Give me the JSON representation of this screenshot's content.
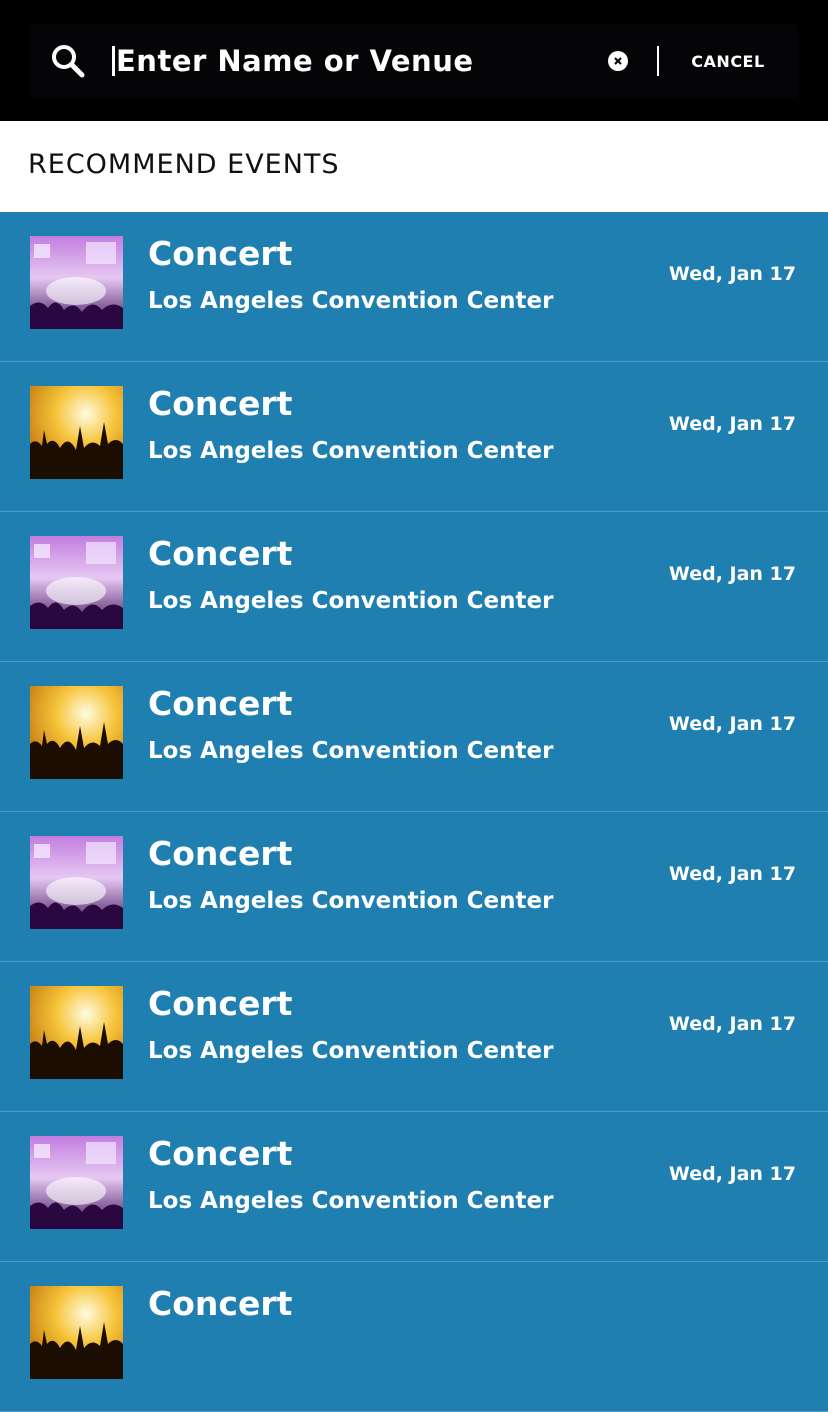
{
  "search": {
    "placeholder": "Enter Name or Venue",
    "value": "",
    "cancel_label": "CANCEL"
  },
  "section": {
    "title": "RECOMMEND EVENTS"
  },
  "events": [
    {
      "title": "Concert",
      "venue": "Los Angeles Convention Center",
      "date": "Wed, Jan 17",
      "thumb": "purple-concert-image"
    },
    {
      "title": "Concert",
      "venue": "Los Angeles Convention Center",
      "date": "Wed, Jan 17",
      "thumb": "golden-crowd-image"
    },
    {
      "title": "Concert",
      "venue": "Los Angeles Convention Center",
      "date": "Wed, Jan 17",
      "thumb": "purple-concert-image"
    },
    {
      "title": "Concert",
      "venue": "Los Angeles Convention Center",
      "date": "Wed, Jan 17",
      "thumb": "golden-crowd-image"
    },
    {
      "title": "Concert",
      "venue": "Los Angeles Convention Center",
      "date": "Wed, Jan 17",
      "thumb": "purple-concert-image"
    },
    {
      "title": "Concert",
      "venue": "Los Angeles Convention Center",
      "date": "Wed, Jan 17",
      "thumb": "golden-crowd-image"
    },
    {
      "title": "Concert",
      "venue": "Los Angeles Convention Center",
      "date": "Wed, Jan 17",
      "thumb": "purple-concert-image"
    },
    {
      "title": "Concert",
      "venue": "",
      "date": "",
      "thumb": "golden-crowd-image"
    }
  ],
  "colors": {
    "topbar": "#000000",
    "list_background": "#1f7fb1",
    "divider": "#4f9cc6",
    "header_background": "#ffffff"
  },
  "icons": {
    "search": "search-icon",
    "clear": "clear-circle-icon"
  }
}
